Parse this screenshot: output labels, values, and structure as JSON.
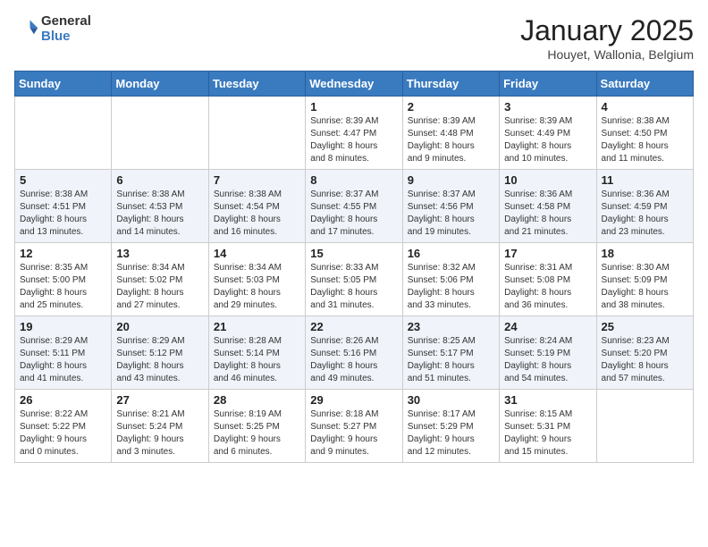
{
  "logo": {
    "general": "General",
    "blue": "Blue"
  },
  "title": "January 2025",
  "location": "Houyet, Wallonia, Belgium",
  "weekdays": [
    "Sunday",
    "Monday",
    "Tuesday",
    "Wednesday",
    "Thursday",
    "Friday",
    "Saturday"
  ],
  "weeks": [
    [
      {
        "day": "",
        "info": ""
      },
      {
        "day": "",
        "info": ""
      },
      {
        "day": "",
        "info": ""
      },
      {
        "day": "1",
        "info": "Sunrise: 8:39 AM\nSunset: 4:47 PM\nDaylight: 8 hours\nand 8 minutes."
      },
      {
        "day": "2",
        "info": "Sunrise: 8:39 AM\nSunset: 4:48 PM\nDaylight: 8 hours\nand 9 minutes."
      },
      {
        "day": "3",
        "info": "Sunrise: 8:39 AM\nSunset: 4:49 PM\nDaylight: 8 hours\nand 10 minutes."
      },
      {
        "day": "4",
        "info": "Sunrise: 8:38 AM\nSunset: 4:50 PM\nDaylight: 8 hours\nand 11 minutes."
      }
    ],
    [
      {
        "day": "5",
        "info": "Sunrise: 8:38 AM\nSunset: 4:51 PM\nDaylight: 8 hours\nand 13 minutes."
      },
      {
        "day": "6",
        "info": "Sunrise: 8:38 AM\nSunset: 4:53 PM\nDaylight: 8 hours\nand 14 minutes."
      },
      {
        "day": "7",
        "info": "Sunrise: 8:38 AM\nSunset: 4:54 PM\nDaylight: 8 hours\nand 16 minutes."
      },
      {
        "day": "8",
        "info": "Sunrise: 8:37 AM\nSunset: 4:55 PM\nDaylight: 8 hours\nand 17 minutes."
      },
      {
        "day": "9",
        "info": "Sunrise: 8:37 AM\nSunset: 4:56 PM\nDaylight: 8 hours\nand 19 minutes."
      },
      {
        "day": "10",
        "info": "Sunrise: 8:36 AM\nSunset: 4:58 PM\nDaylight: 8 hours\nand 21 minutes."
      },
      {
        "day": "11",
        "info": "Sunrise: 8:36 AM\nSunset: 4:59 PM\nDaylight: 8 hours\nand 23 minutes."
      }
    ],
    [
      {
        "day": "12",
        "info": "Sunrise: 8:35 AM\nSunset: 5:00 PM\nDaylight: 8 hours\nand 25 minutes."
      },
      {
        "day": "13",
        "info": "Sunrise: 8:34 AM\nSunset: 5:02 PM\nDaylight: 8 hours\nand 27 minutes."
      },
      {
        "day": "14",
        "info": "Sunrise: 8:34 AM\nSunset: 5:03 PM\nDaylight: 8 hours\nand 29 minutes."
      },
      {
        "day": "15",
        "info": "Sunrise: 8:33 AM\nSunset: 5:05 PM\nDaylight: 8 hours\nand 31 minutes."
      },
      {
        "day": "16",
        "info": "Sunrise: 8:32 AM\nSunset: 5:06 PM\nDaylight: 8 hours\nand 33 minutes."
      },
      {
        "day": "17",
        "info": "Sunrise: 8:31 AM\nSunset: 5:08 PM\nDaylight: 8 hours\nand 36 minutes."
      },
      {
        "day": "18",
        "info": "Sunrise: 8:30 AM\nSunset: 5:09 PM\nDaylight: 8 hours\nand 38 minutes."
      }
    ],
    [
      {
        "day": "19",
        "info": "Sunrise: 8:29 AM\nSunset: 5:11 PM\nDaylight: 8 hours\nand 41 minutes."
      },
      {
        "day": "20",
        "info": "Sunrise: 8:29 AM\nSunset: 5:12 PM\nDaylight: 8 hours\nand 43 minutes."
      },
      {
        "day": "21",
        "info": "Sunrise: 8:28 AM\nSunset: 5:14 PM\nDaylight: 8 hours\nand 46 minutes."
      },
      {
        "day": "22",
        "info": "Sunrise: 8:26 AM\nSunset: 5:16 PM\nDaylight: 8 hours\nand 49 minutes."
      },
      {
        "day": "23",
        "info": "Sunrise: 8:25 AM\nSunset: 5:17 PM\nDaylight: 8 hours\nand 51 minutes."
      },
      {
        "day": "24",
        "info": "Sunrise: 8:24 AM\nSunset: 5:19 PM\nDaylight: 8 hours\nand 54 minutes."
      },
      {
        "day": "25",
        "info": "Sunrise: 8:23 AM\nSunset: 5:20 PM\nDaylight: 8 hours\nand 57 minutes."
      }
    ],
    [
      {
        "day": "26",
        "info": "Sunrise: 8:22 AM\nSunset: 5:22 PM\nDaylight: 9 hours\nand 0 minutes."
      },
      {
        "day": "27",
        "info": "Sunrise: 8:21 AM\nSunset: 5:24 PM\nDaylight: 9 hours\nand 3 minutes."
      },
      {
        "day": "28",
        "info": "Sunrise: 8:19 AM\nSunset: 5:25 PM\nDaylight: 9 hours\nand 6 minutes."
      },
      {
        "day": "29",
        "info": "Sunrise: 8:18 AM\nSunset: 5:27 PM\nDaylight: 9 hours\nand 9 minutes."
      },
      {
        "day": "30",
        "info": "Sunrise: 8:17 AM\nSunset: 5:29 PM\nDaylight: 9 hours\nand 12 minutes."
      },
      {
        "day": "31",
        "info": "Sunrise: 8:15 AM\nSunset: 5:31 PM\nDaylight: 9 hours\nand 15 minutes."
      },
      {
        "day": "",
        "info": ""
      }
    ]
  ]
}
